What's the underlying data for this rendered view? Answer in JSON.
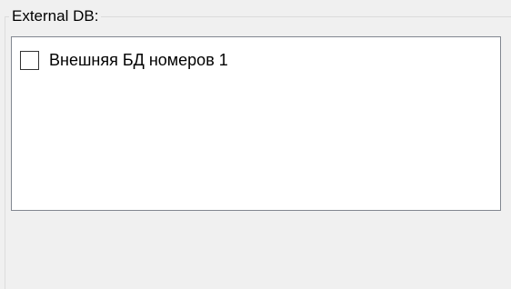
{
  "group": {
    "title": "External DB:"
  },
  "list": {
    "items": [
      {
        "label": "Внешняя БД номеров 1",
        "checked": false
      }
    ]
  },
  "colors": {
    "background": "#f0f0f0",
    "list_background": "#ffffff",
    "list_border": "#828790",
    "group_border": "#dcdcdc",
    "checkbox_border": "#333333"
  }
}
